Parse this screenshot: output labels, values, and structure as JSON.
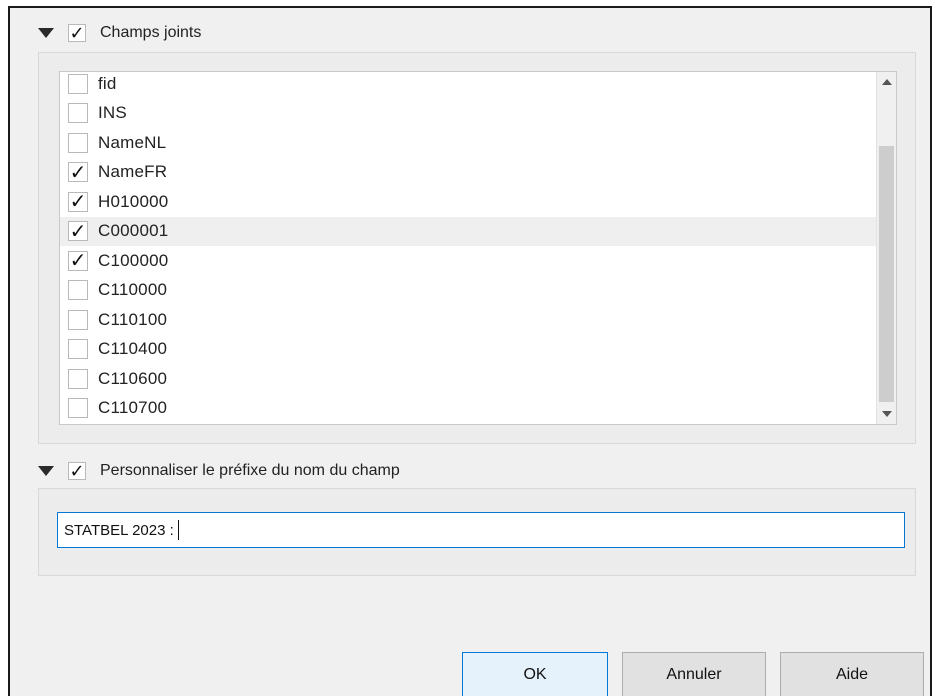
{
  "joined_fields": {
    "title": "Champs joints",
    "checked": true,
    "fields": [
      {
        "name": "fid",
        "checked": false
      },
      {
        "name": "INS",
        "checked": false
      },
      {
        "name": "NameNL",
        "checked": false
      },
      {
        "name": "NameFR",
        "checked": true
      },
      {
        "name": "H010000",
        "checked": true
      },
      {
        "name": "C000001",
        "checked": true
      },
      {
        "name": "C100000",
        "checked": true
      },
      {
        "name": "C110000",
        "checked": false
      },
      {
        "name": "C110100",
        "checked": false
      },
      {
        "name": "C110400",
        "checked": false
      },
      {
        "name": "C110600",
        "checked": false
      },
      {
        "name": "C110700",
        "checked": false
      }
    ],
    "highlighted_index": 5
  },
  "prefix": {
    "title": "Personnaliser le préfixe du nom du champ",
    "checked": true,
    "value": "STATBEL 2023 :"
  },
  "buttons": {
    "ok": "OK",
    "cancel": "Annuler",
    "help": "Aide"
  },
  "icons": {
    "collapse": "triangle-down-icon",
    "check": "checkmark-icon",
    "scroll_up": "arrow-up-icon",
    "scroll_down": "arrow-down-icon"
  },
  "colors": {
    "focus": "#0078d7",
    "panel": "#ececec",
    "highlight_row": "#efefef"
  }
}
